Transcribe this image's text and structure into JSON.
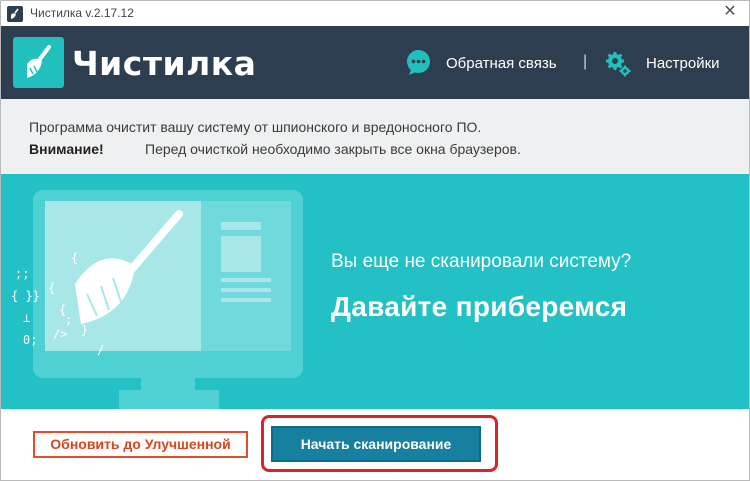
{
  "window": {
    "title": "Чистилка v.2.17.12",
    "close_symbol": "✕"
  },
  "header": {
    "logo_text": "Чистилка",
    "feedback_label": "Обратная связь",
    "separator": "|",
    "settings_label": "Настройки",
    "colors": {
      "background": "#2d3e50",
      "accent": "#22bfbf"
    }
  },
  "notice": {
    "line1": "Программа очистит вашу систему от шпионского и вредоносного ПО.",
    "warning_label": "Внимание!",
    "line2": "Перед очисткой необходимо закрыть все окна браузеров."
  },
  "hero": {
    "question": "Вы еще не сканировали систему?",
    "call_to_action": "Давайте приберемся",
    "background_color": "#23c1c5"
  },
  "actions": {
    "upgrade_label": "Обновить до Улучшенной",
    "scan_label": "Начать сканирование",
    "highlight_color": "#d9232d"
  }
}
